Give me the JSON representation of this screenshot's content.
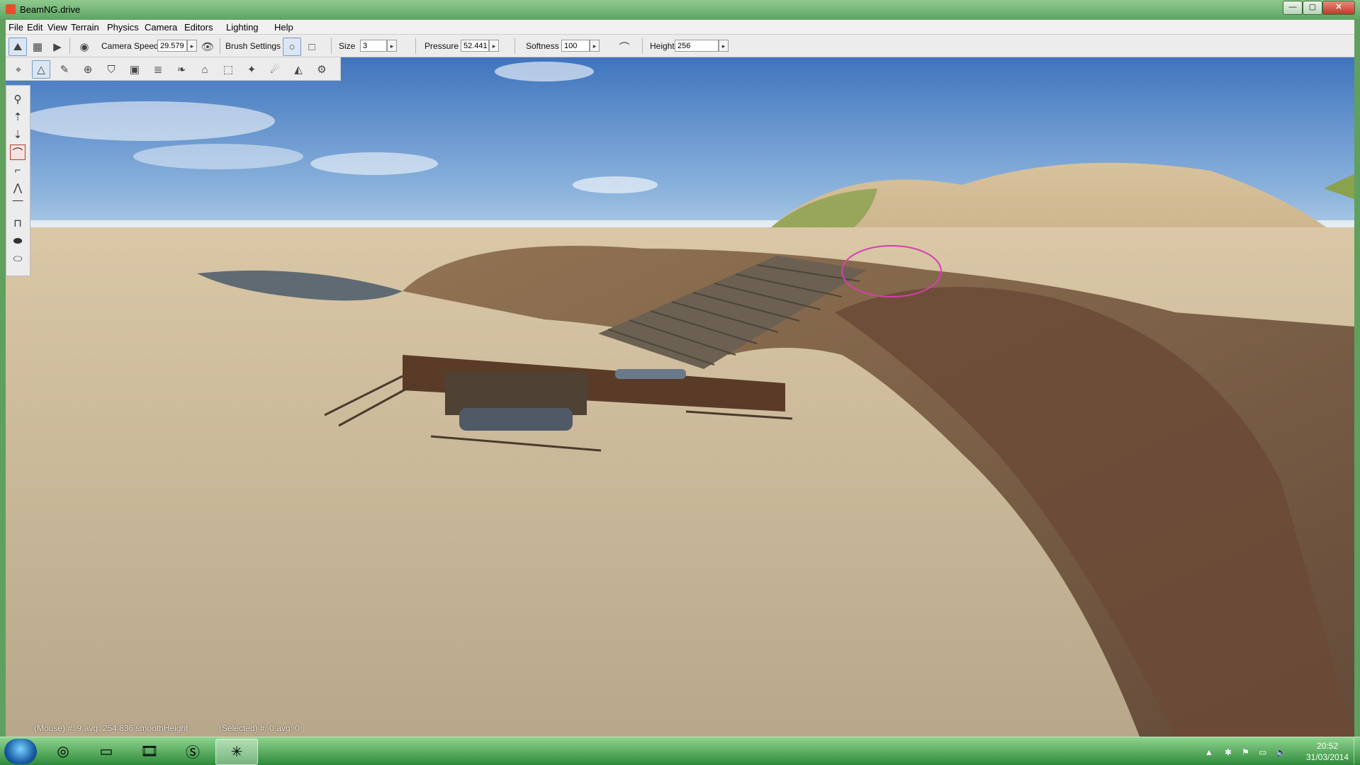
{
  "window": {
    "title": "BeamNG.drive",
    "min": "—",
    "max": "▢",
    "close": "✕"
  },
  "menubar": {
    "items": [
      "File",
      "Edit",
      "View",
      "Terrain",
      "Physics",
      "Camera",
      "Editors",
      "Lighting",
      "Help"
    ]
  },
  "toolbar": {
    "camera_speed_label": "Camera Speed",
    "camera_speed_value": "29.579",
    "brush_settings_label": "Brush Settings",
    "size_label": "Size",
    "size_value": "3",
    "pressure_label": "Pressure",
    "pressure_value": "52.441",
    "softness_label": "Softness",
    "softness_value": "100",
    "height_label": "Height",
    "height_value": "256",
    "arrow": "▸"
  },
  "terrain_tools": [
    "select-terrain-icon",
    "raise-height-icon",
    "paint-material-icon",
    "smooth-icon",
    "shield-icon",
    "image-icon",
    "stack-icon",
    "feather-icon",
    "stamp-icon",
    "bounds-icon",
    "rock-icon",
    "noise-icon",
    "slope-icon",
    "mesh-icon"
  ],
  "brush_palette": [
    "adjust-height-icon",
    "raise-icon",
    "lower-icon",
    "smooth-height-icon",
    "flatten-icon",
    "noise-brush-icon",
    "set-height-icon",
    "clear-terrain-icon",
    "paint-hole-icon",
    "fill-hole-icon"
  ],
  "statusbar": {
    "mouse": "(Mouse) #: 9  avg: 254.836  smoothHeight",
    "selected": "(Selected) #: 0  avg: 0"
  },
  "taskbar": {
    "apps": [
      "chrome-app",
      "file-explorer-app",
      "media-player-app",
      "skype-app",
      "beamng-app"
    ],
    "clock_time": "20:52",
    "clock_date": "31/03/2014"
  },
  "colors": {
    "sky_top": "#4a7fc2",
    "sand": "#c8b89a",
    "brush_ring": "#d63fae",
    "taskbar": "#3c9a45"
  }
}
